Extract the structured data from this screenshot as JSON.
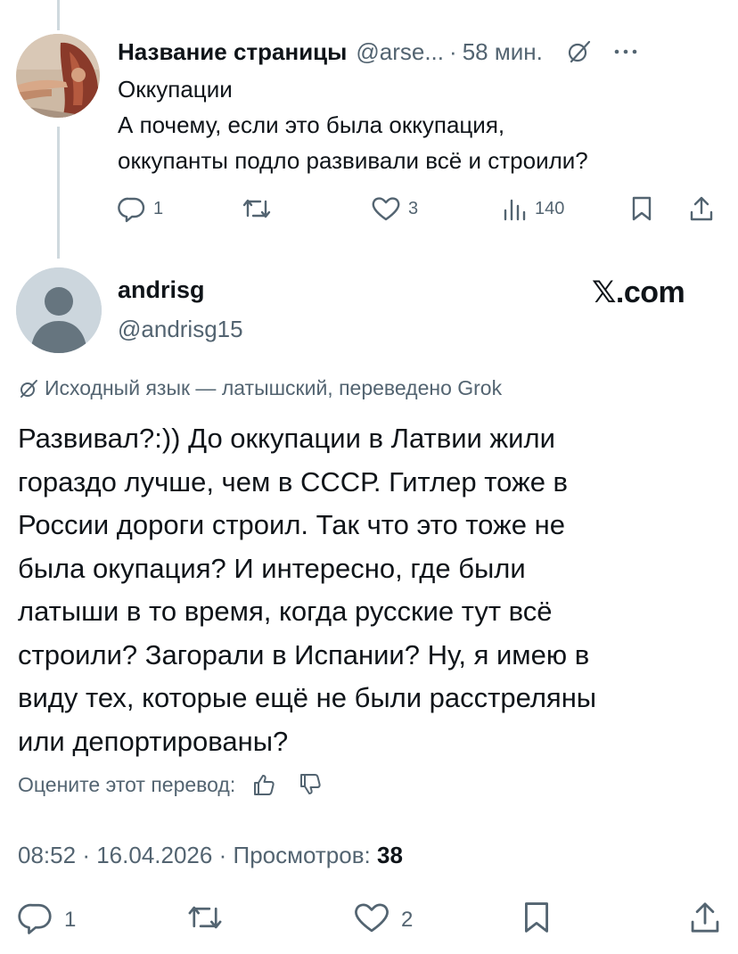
{
  "parent": {
    "display_name": "Название страницы",
    "handle": "@arse...",
    "separator": "·",
    "time": "58 мин.",
    "lines": [
      "Оккупации",
      "А почему, если это была оккупация,",
      "оккупанты подло развивали всё и строили?"
    ],
    "replies": "1",
    "likes": "3",
    "views": "140"
  },
  "tweet": {
    "display_name": "andrisg",
    "handle": "@andrisg15",
    "brand": "𝕏.com",
    "translation_note": "Исходный язык — латышский, переведено Grok",
    "lines": [
      "Развивал?:)) До оккупации в Латвии жили",
      "гораздо лучше, чем в СССР. Гитлер тоже в",
      "России дороги строил. Так что это тоже не",
      "была окупация? И интересно, где были",
      "латыши в то время, когда русские тут всё",
      "строили? Загорали в Испании? Ну, я имею в",
      "виду тех, которые ещё не были расстреляны",
      "или депортированы?"
    ],
    "rate_label": "Оцените этот перевод:",
    "time": "08:52",
    "separator": "·",
    "date": "16.04.2026",
    "views_label": "Просмотров:",
    "views": "38",
    "replies": "1",
    "likes": "2"
  },
  "colors": {
    "text": "#0f1419",
    "muted": "#536471",
    "thread": "#cfd9de"
  },
  "icons": [
    "reply-icon",
    "retweet-icon",
    "like-icon",
    "views-icon",
    "bookmark-icon",
    "share-icon",
    "grok-translate-icon",
    "more-icon",
    "thumbs-up-icon",
    "thumbs-down-icon"
  ]
}
